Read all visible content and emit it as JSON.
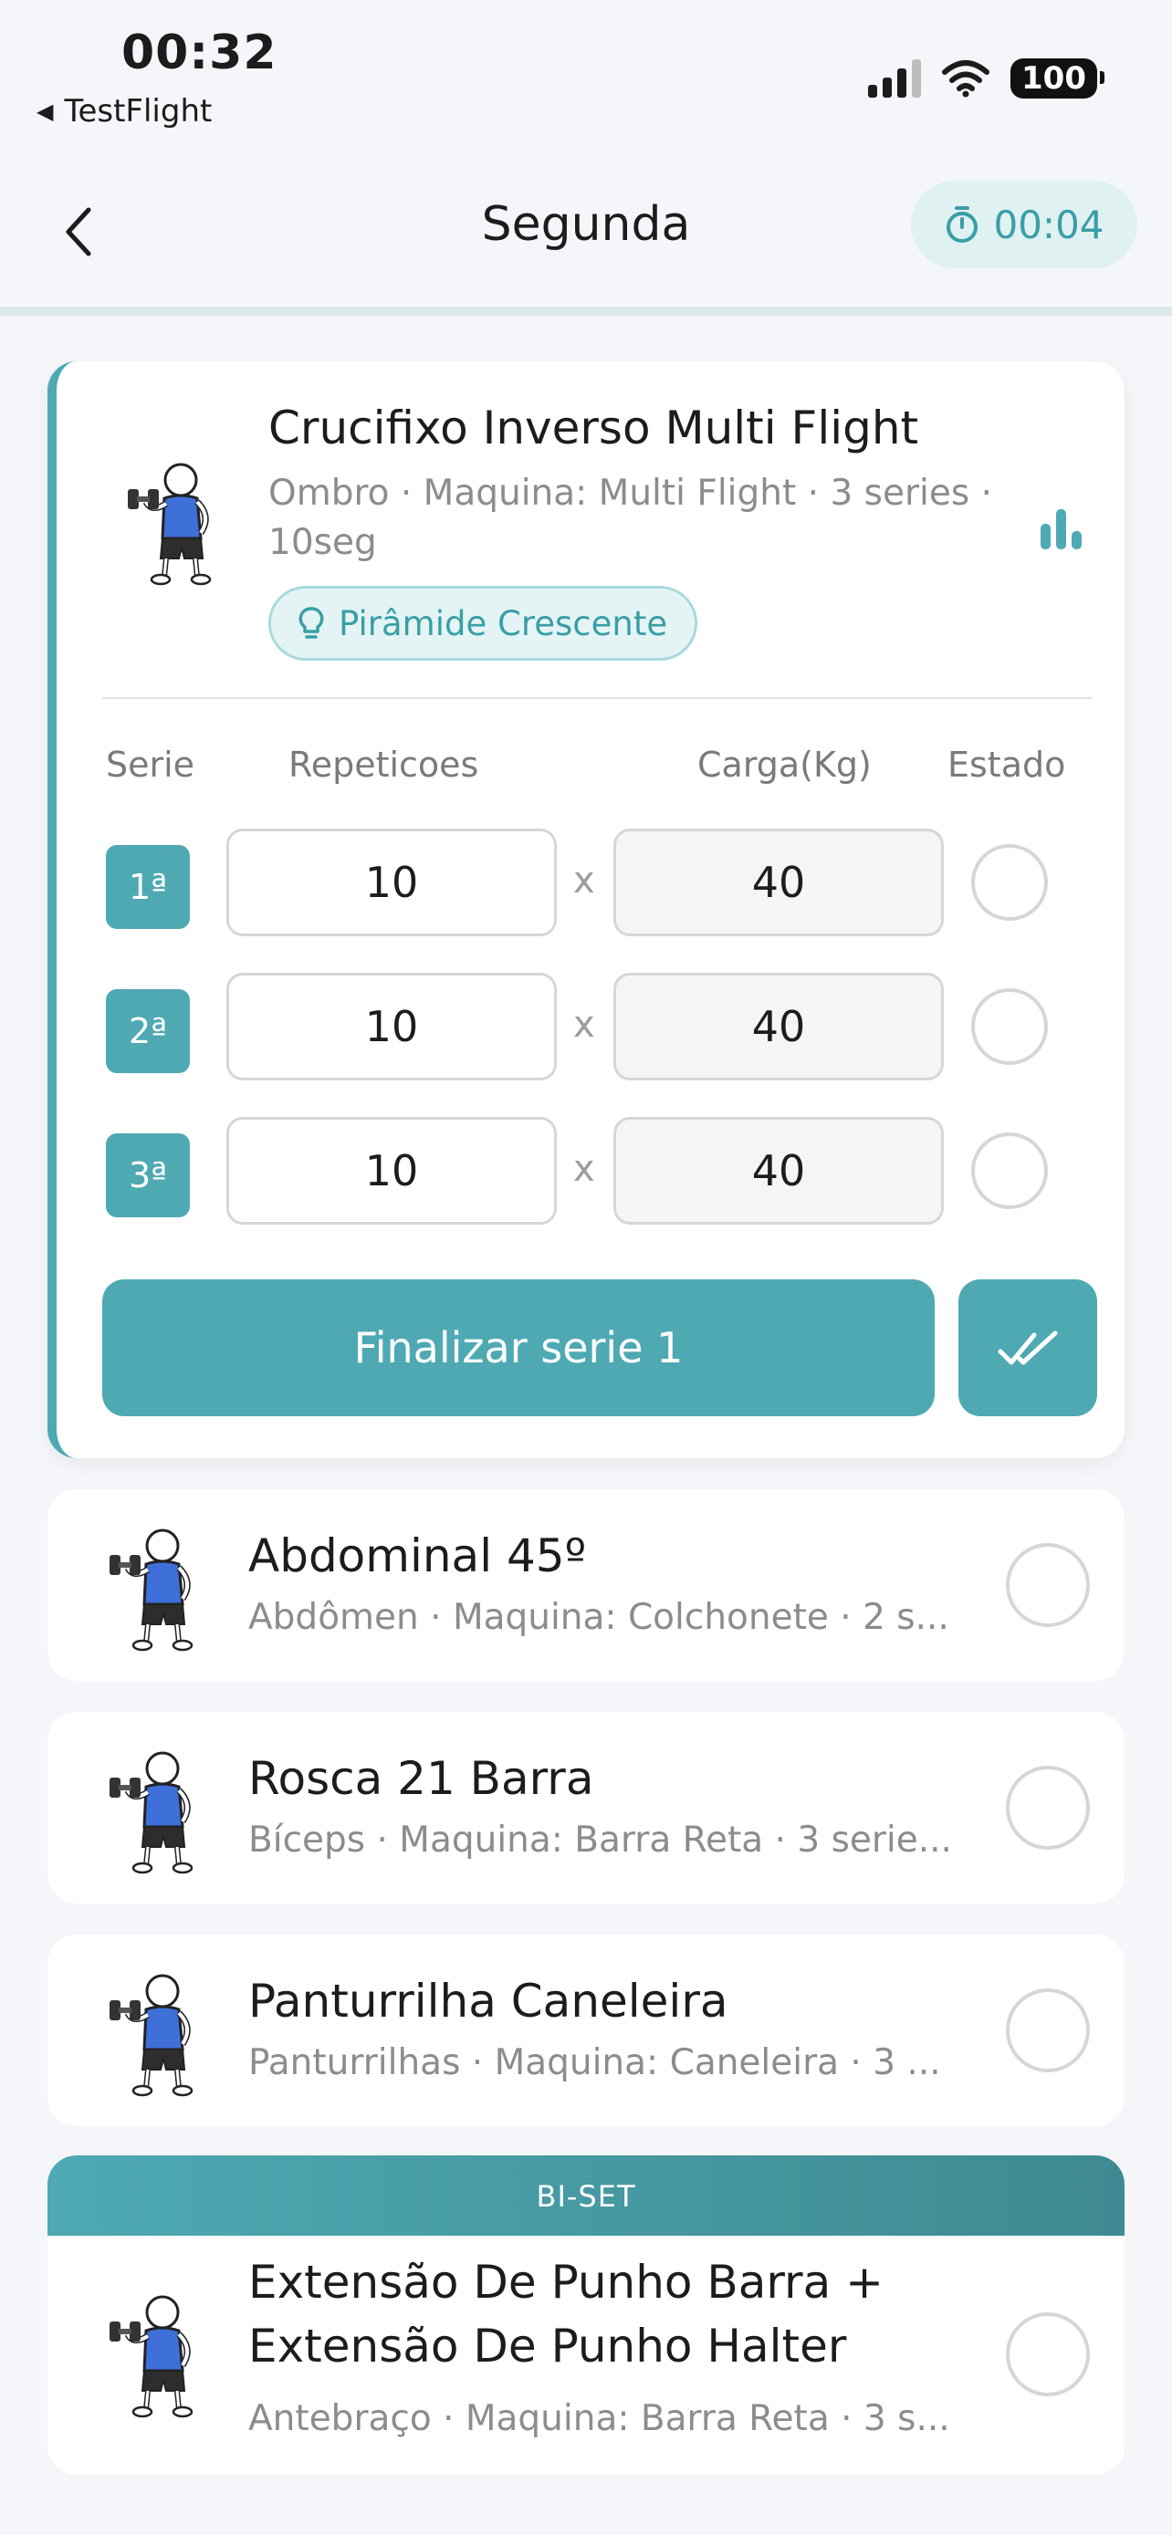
{
  "status_bar": {
    "time": "00:32",
    "back_app": "TestFlight",
    "battery": "100"
  },
  "header": {
    "title": "Segunda",
    "timer": "00:04"
  },
  "active_exercise": {
    "title": "Crucifixo Inverso Multi Flight",
    "subtitle": "Ombro · Maquina: Multi Flight · 3 series · 10seg",
    "tag": "Pirâmide Crescente",
    "columns": {
      "serie": "Serie",
      "reps": "Repeticoes",
      "load": "Carga(Kg)",
      "status": "Estado"
    },
    "sets": [
      {
        "label": "1ª",
        "reps": "10",
        "load": "40",
        "separator": "x"
      },
      {
        "label": "2ª",
        "reps": "10",
        "load": "40",
        "separator": "x"
      },
      {
        "label": "3ª",
        "reps": "10",
        "load": "40",
        "separator": "x"
      }
    ],
    "finish_label": "Finalizar serie 1"
  },
  "exercises": [
    {
      "name": "Abdominal 45º",
      "subtitle": "Abdômen · Maquina: Colchonete · 2 s..."
    },
    {
      "name": "Rosca 21 Barra",
      "subtitle": "Bíceps · Maquina: Barra Reta · 3 serie..."
    },
    {
      "name": "Panturrilha Caneleira",
      "subtitle": "Panturrilhas · Maquina: Caneleira · 3 ..."
    }
  ],
  "biset": {
    "label": "BI-SET",
    "name_line1": "Extensão De Punho Barra +",
    "name_line2": "Extensão De Punho Halter",
    "subtitle": "Antebraço · Maquina: Barra Reta · 3 s..."
  },
  "colors": {
    "accent": "#4ea9b3",
    "accent_light": "#dff1f1",
    "muted_text": "#8c8c8c",
    "border": "#d6d6d6"
  },
  "icons": [
    "back-arrow-icon",
    "stopwatch-icon",
    "bar-chart-icon",
    "lightbulb-icon",
    "double-check-icon",
    "athlete-dumbbell-icon"
  ]
}
